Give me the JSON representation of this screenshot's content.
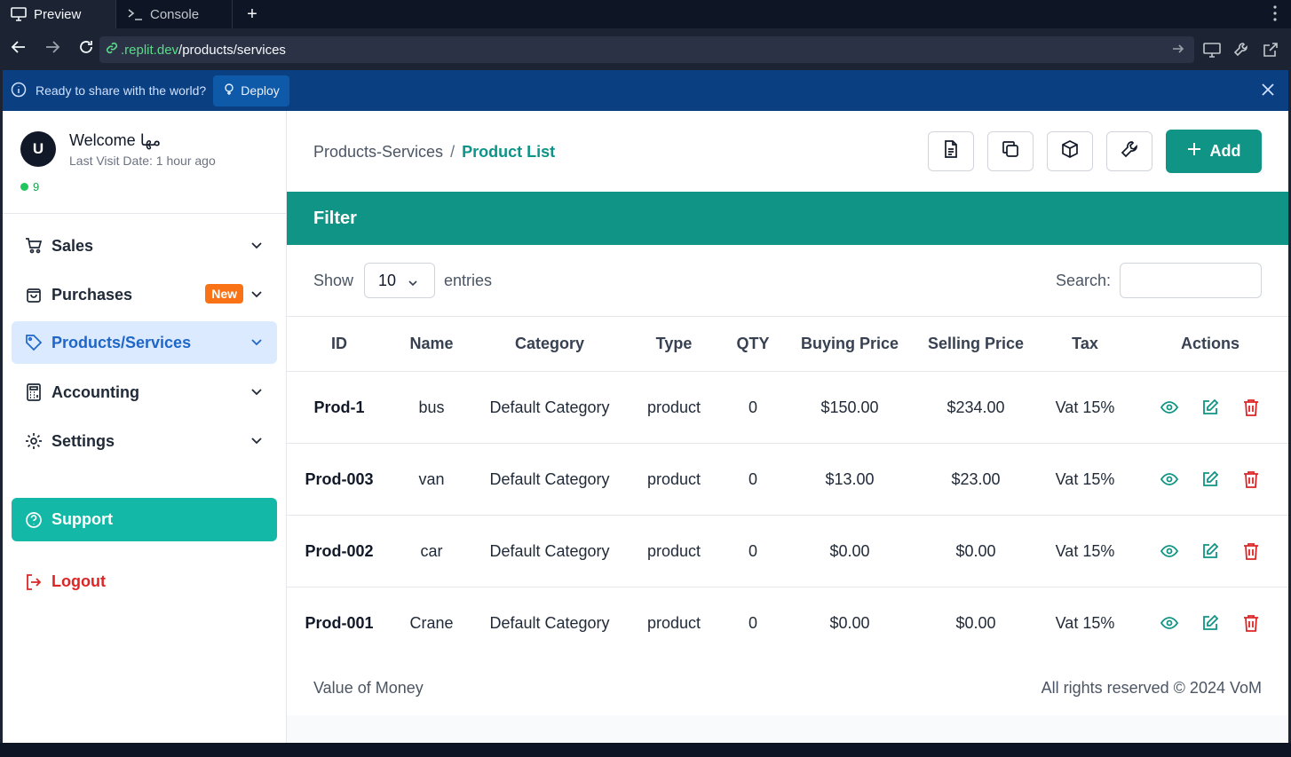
{
  "browser": {
    "tabs": [
      {
        "label": "Preview",
        "icon": "monitor-icon",
        "active": true
      },
      {
        "label": "Console",
        "icon": "terminal-icon",
        "active": false
      }
    ],
    "new_tab": "+",
    "url_domain": ".replit.dev",
    "url_path": "/products/services"
  },
  "deploy_banner": {
    "message": "Ready to share with the world?",
    "button": "Deploy"
  },
  "sidebar": {
    "avatar_letter": "U",
    "welcome": "Welcome مها",
    "last_visit": "Last Visit Date: 1 hour ago",
    "online_count": "9",
    "items": [
      {
        "label": "Sales",
        "icon": "cart-icon"
      },
      {
        "label": "Purchases",
        "icon": "bag-icon",
        "badge": "New"
      },
      {
        "label": "Products/Services",
        "icon": "tag-icon",
        "active": true
      },
      {
        "label": "Accounting",
        "icon": "calculator-icon"
      },
      {
        "label": "Settings",
        "icon": "gear-icon"
      }
    ],
    "support": "Support",
    "logout": "Logout"
  },
  "header": {
    "breadcrumb_parent": "Products-Services",
    "breadcrumb_sep": "/",
    "breadcrumb_current": "Product List",
    "add_label": "Add"
  },
  "filter": {
    "title": "Filter"
  },
  "table_controls": {
    "show_label": "Show",
    "entries_value": "10",
    "entries_label": "entries",
    "search_label": "Search:"
  },
  "table": {
    "columns": [
      "ID",
      "Name",
      "Category",
      "Type",
      "QTY",
      "Buying Price",
      "Selling Price",
      "Tax",
      "Actions"
    ],
    "rows": [
      {
        "id": "Prod-1",
        "name": "bus",
        "category": "Default Category",
        "type": "product",
        "qty": "0",
        "buying": "$150.00",
        "selling": "$234.00",
        "tax": "Vat 15%"
      },
      {
        "id": "Prod-003",
        "name": "van",
        "category": "Default Category",
        "type": "product",
        "qty": "0",
        "buying": "$13.00",
        "selling": "$23.00",
        "tax": "Vat 15%"
      },
      {
        "id": "Prod-002",
        "name": "car",
        "category": "Default Category",
        "type": "product",
        "qty": "0",
        "buying": "$0.00",
        "selling": "$0.00",
        "tax": "Vat 15%"
      },
      {
        "id": "Prod-001",
        "name": "Crane",
        "category": "Default Category",
        "type": "product",
        "qty": "0",
        "buying": "$0.00",
        "selling": "$0.00",
        "tax": "Vat 15%"
      }
    ]
  },
  "footer": {
    "left": "Value of Money",
    "right": "All rights reserved © 2024 VoM"
  },
  "colors": {
    "teal": "#0f9485",
    "support_teal": "#14b8a6",
    "active_bg": "#dbeafe",
    "active_text": "#1e66c8",
    "danger": "#dc2626",
    "badge_orange": "#f97316"
  }
}
